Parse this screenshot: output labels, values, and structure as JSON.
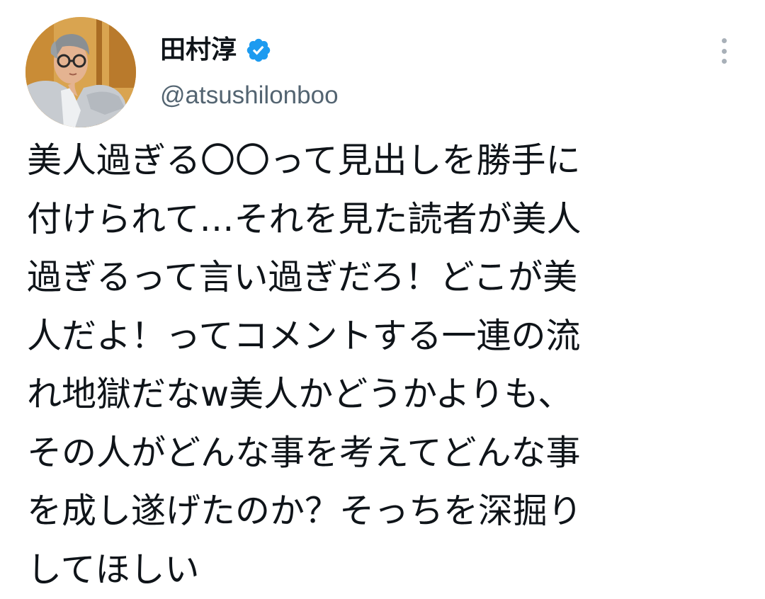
{
  "author": {
    "display_name": "田村淳",
    "handle": "@atsushilonboo",
    "verified": true,
    "avatar_icon": "profile-photo",
    "verified_icon": "verified-badge-icon",
    "more_icon": "more-vertical-icon"
  },
  "tweet": {
    "lines": [
      "美人過ぎる〇〇って見出しを勝手に",
      "付けられて…それを見た読者が美人",
      "過ぎるって言い過ぎだろ！どこが美",
      "人だよ！ってコメントする一連の流",
      "れ地獄だなw美人かどうかよりも、",
      "その人がどんな事を考えてどんな事",
      "を成し遂げたのか？そっちを深掘り",
      "してほしい"
    ]
  },
  "colors": {
    "text": "#0f1419",
    "secondary_text": "#536471",
    "verified_blue": "#1d9bf0",
    "more_icon": "#a8b0b8"
  }
}
